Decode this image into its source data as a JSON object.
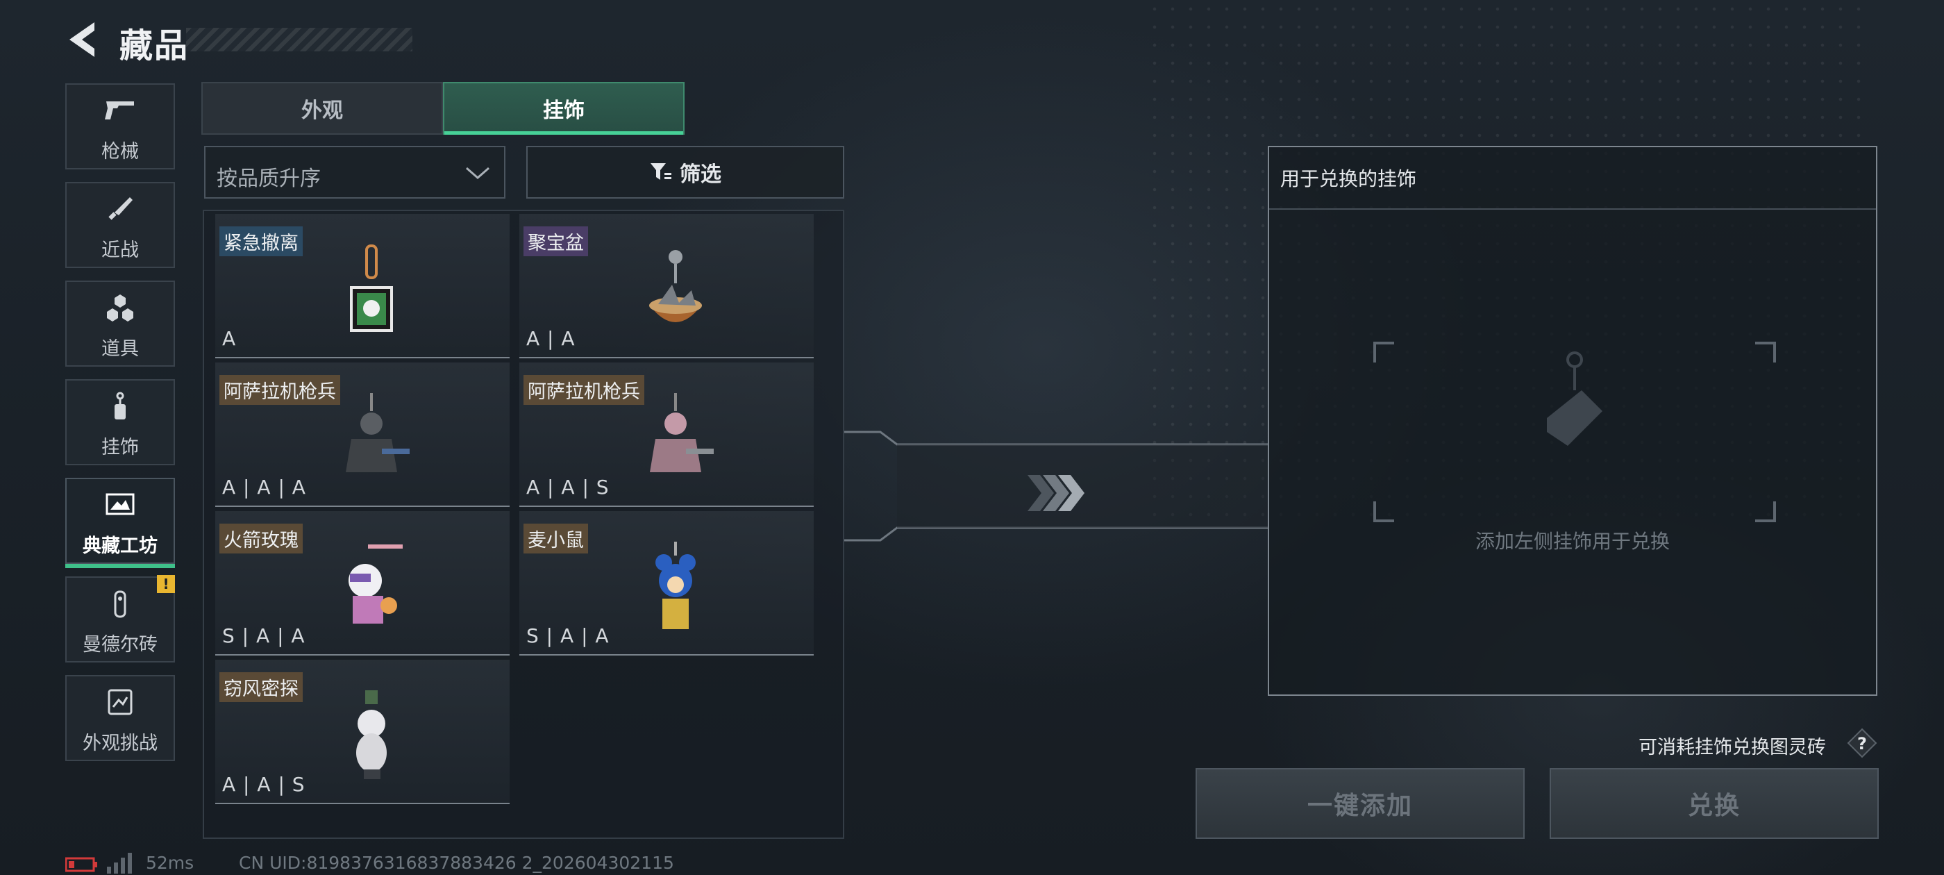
{
  "header": {
    "title": "藏品"
  },
  "sidebar": {
    "items": [
      {
        "label": "枪械",
        "icon": "gun-icon"
      },
      {
        "label": "近战",
        "icon": "knife-icon"
      },
      {
        "label": "道具",
        "icon": "items-icon"
      },
      {
        "label": "挂饰",
        "icon": "charm-icon"
      },
      {
        "label": "典藏工坊",
        "icon": "workshop-icon",
        "active": true
      },
      {
        "label": "曼德尔砖",
        "icon": "brick-icon",
        "badge": "!"
      },
      {
        "label": "外观挑战",
        "icon": "challenge-icon"
      }
    ]
  },
  "tabs": [
    {
      "label": "外观",
      "active": false
    },
    {
      "label": "挂饰",
      "active": true
    }
  ],
  "controls": {
    "sort_value": "按品质升序",
    "filter_label": "筛选"
  },
  "charms": [
    {
      "name": "紧急撤离",
      "grade": "A",
      "name_bg": "#2b4a63"
    },
    {
      "name": "聚宝盆",
      "grade": "A | A",
      "name_bg": "#4a3d66"
    },
    {
      "name": "阿萨拉机枪兵",
      "grade": "A | A | A",
      "name_bg": "#5a4a36"
    },
    {
      "name": "阿萨拉机枪兵",
      "grade": "A | A | S",
      "name_bg": "#5a4a36"
    },
    {
      "name": "火箭玫瑰",
      "grade": "S | A | A",
      "name_bg": "#5a4a36"
    },
    {
      "name": "麦小鼠",
      "grade": "S | A | A",
      "name_bg": "#5a4a36"
    },
    {
      "name": "窃风密探",
      "grade": "A | A | S",
      "name_bg": "#5a4a36"
    }
  ],
  "exchange": {
    "title": "用于兑换的挂饰",
    "hint": "添加左侧挂饰用于兑换",
    "consume_label": "可消耗挂饰兑换图灵砖",
    "add_all_label": "一键添加",
    "exchange_label": "兑换"
  },
  "status": {
    "ping": "52ms",
    "uid": "CN UID:8198376316837883426 2_202604302115"
  },
  "colors": {
    "accent": "#3fc08a",
    "warning": "#e9b630",
    "battery_low": "#d33a3a"
  }
}
